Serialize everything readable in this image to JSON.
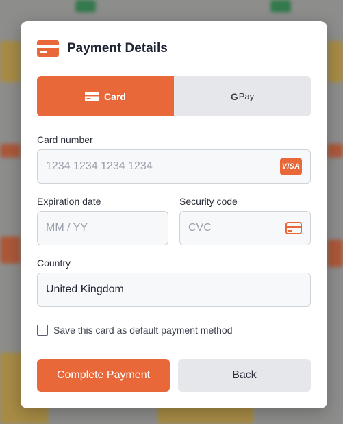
{
  "modal": {
    "title": "Payment Details",
    "tabs": [
      {
        "label": "Card",
        "icon": "credit-card-icon",
        "active": true
      },
      {
        "label": "Pay",
        "prefix": "G",
        "icon": "google-pay-logo",
        "active": false
      }
    ],
    "card_number": {
      "label": "Card number",
      "placeholder": "1234 1234 1234 1234",
      "brand": "VISA"
    },
    "expiration": {
      "label": "Expiration date",
      "placeholder": "MM / YY"
    },
    "security": {
      "label": "Security code",
      "placeholder": "CVC",
      "icon": "card-icon"
    },
    "country": {
      "label": "Country",
      "value": "United Kingdom"
    },
    "save_card": {
      "label": "Save this card as default payment method",
      "checked": false
    },
    "buttons": {
      "primary": "Complete Payment",
      "secondary": "Back"
    }
  },
  "colors": {
    "accent": "#e8683a",
    "tab_inactive": "#e6e7ea",
    "text": "#1f2433"
  }
}
